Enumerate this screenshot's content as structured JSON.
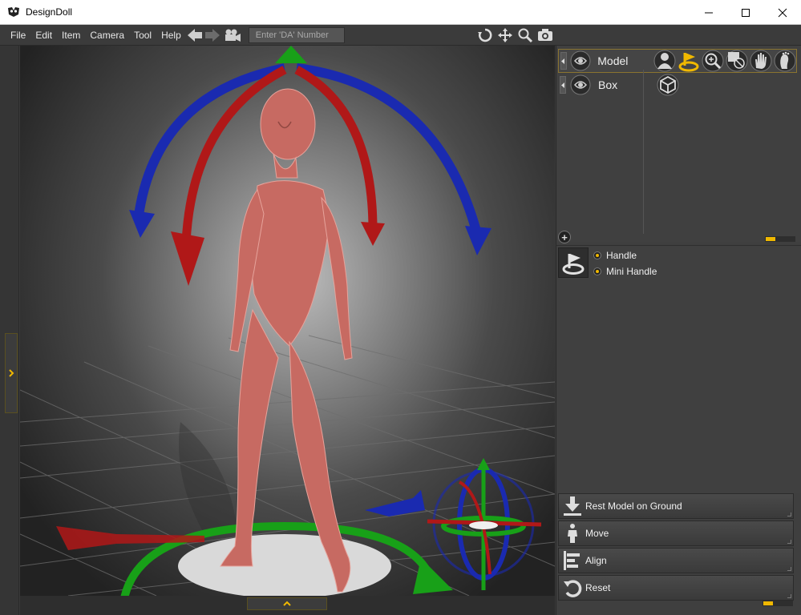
{
  "window": {
    "title": "DesignDoll",
    "minimize_glyph": "—",
    "maximize_glyph": "☐",
    "close_glyph": "✕"
  },
  "menu": {
    "items": [
      "File",
      "Edit",
      "Item",
      "Camera",
      "Tool",
      "Help"
    ],
    "da_placeholder": "Enter 'DA' Number"
  },
  "icons": {
    "app": "designdoll-logo-icon",
    "back": "back-arrow-icon",
    "forward": "forward-arrow-icon",
    "camera": "movie-camera-icon",
    "rotate": "rotate-view-icon",
    "pan": "pan-view-icon",
    "zoom": "zoom-view-icon",
    "screenshot": "screenshot-camera-icon"
  },
  "objects": [
    {
      "label": "Model",
      "selected": true
    },
    {
      "label": "Box",
      "selected": false
    }
  ],
  "handle_options": [
    {
      "label": "Handle",
      "selected": true
    },
    {
      "label": "Mini Handle",
      "selected": true
    }
  ],
  "actions": [
    {
      "label": "Rest Model on Ground",
      "icon": "rest-on-ground-icon"
    },
    {
      "label": "Move",
      "icon": "move-figure-icon"
    },
    {
      "label": "Align",
      "icon": "align-icon"
    },
    {
      "label": "Reset",
      "icon": "reset-icon"
    }
  ],
  "colors": {
    "accent": "#f0b800",
    "gizmo_red": "#b01818",
    "gizmo_blue": "#1a2ab0",
    "gizmo_green": "#18a018",
    "figure": "#c76a62"
  }
}
